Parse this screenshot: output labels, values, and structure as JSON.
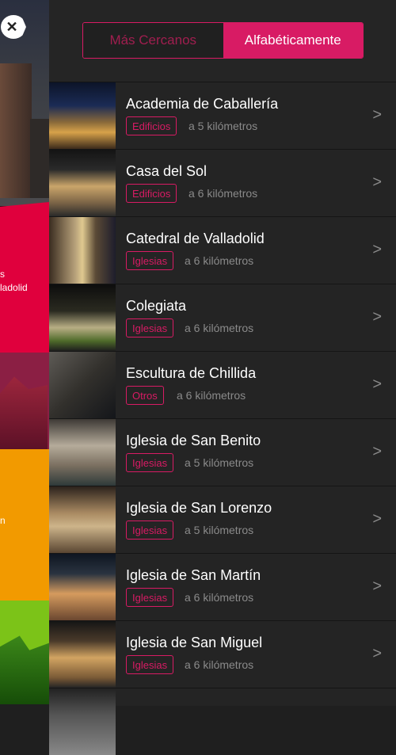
{
  "segmented": {
    "nearest": "Más Cercanos",
    "alphabetical": "Alfabéticamente",
    "active": "alphabetical"
  },
  "left_drawer": {
    "red_lines": [
      "s",
      "ladolid"
    ],
    "orange_line": "n"
  },
  "places": [
    {
      "name": "Academia de Caballería",
      "category": "Edificios",
      "distance": "a 5 kilómetros"
    },
    {
      "name": "Casa del Sol",
      "category": "Edificios",
      "distance": "a 6 kilómetros"
    },
    {
      "name": "Catedral de Valladolid",
      "category": "Iglesias",
      "distance": "a 6 kilómetros"
    },
    {
      "name": "Colegiata",
      "category": "Iglesias",
      "distance": "a 6 kilómetros"
    },
    {
      "name": "Escultura de Chillida",
      "category": "Otros",
      "distance": "a 6 kilómetros"
    },
    {
      "name": "Iglesia de San Benito",
      "category": "Iglesias",
      "distance": "a 5 kilómetros"
    },
    {
      "name": "Iglesia de San Lorenzo",
      "category": "Iglesias",
      "distance": "a 5 kilómetros"
    },
    {
      "name": "Iglesia de San Martín",
      "category": "Iglesias",
      "distance": "a 6 kilómetros"
    },
    {
      "name": "Iglesia de San Miguel",
      "category": "Iglesias",
      "distance": "a 6 kilómetros"
    }
  ],
  "colors": {
    "accent": "#d81b64",
    "background": "#252525"
  }
}
